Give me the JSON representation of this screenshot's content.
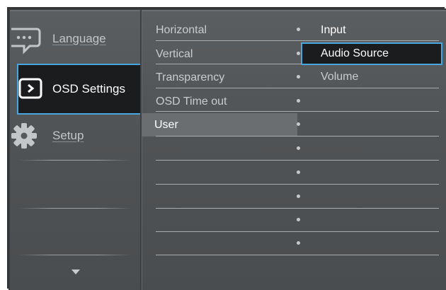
{
  "sidebar": {
    "items": [
      {
        "label": "Language",
        "icon": "speech-bubble-icon"
      },
      {
        "label": "OSD Settings",
        "icon": "monitor-icon"
      },
      {
        "label": "Setup",
        "icon": "gear-icon"
      }
    ],
    "more_icon": "down-arrow-icon"
  },
  "middle": {
    "items": [
      "Horizontal",
      "Vertical",
      "Transparency",
      "OSD Time out",
      "User"
    ]
  },
  "options": {
    "items": [
      "Input",
      "Audio Source",
      "Volume"
    ]
  },
  "colors": {
    "accent": "#4aa6de",
    "panel": "#55585a",
    "selected_bg": "#1b1c1d",
    "highlight_row": "#6b6e70"
  }
}
